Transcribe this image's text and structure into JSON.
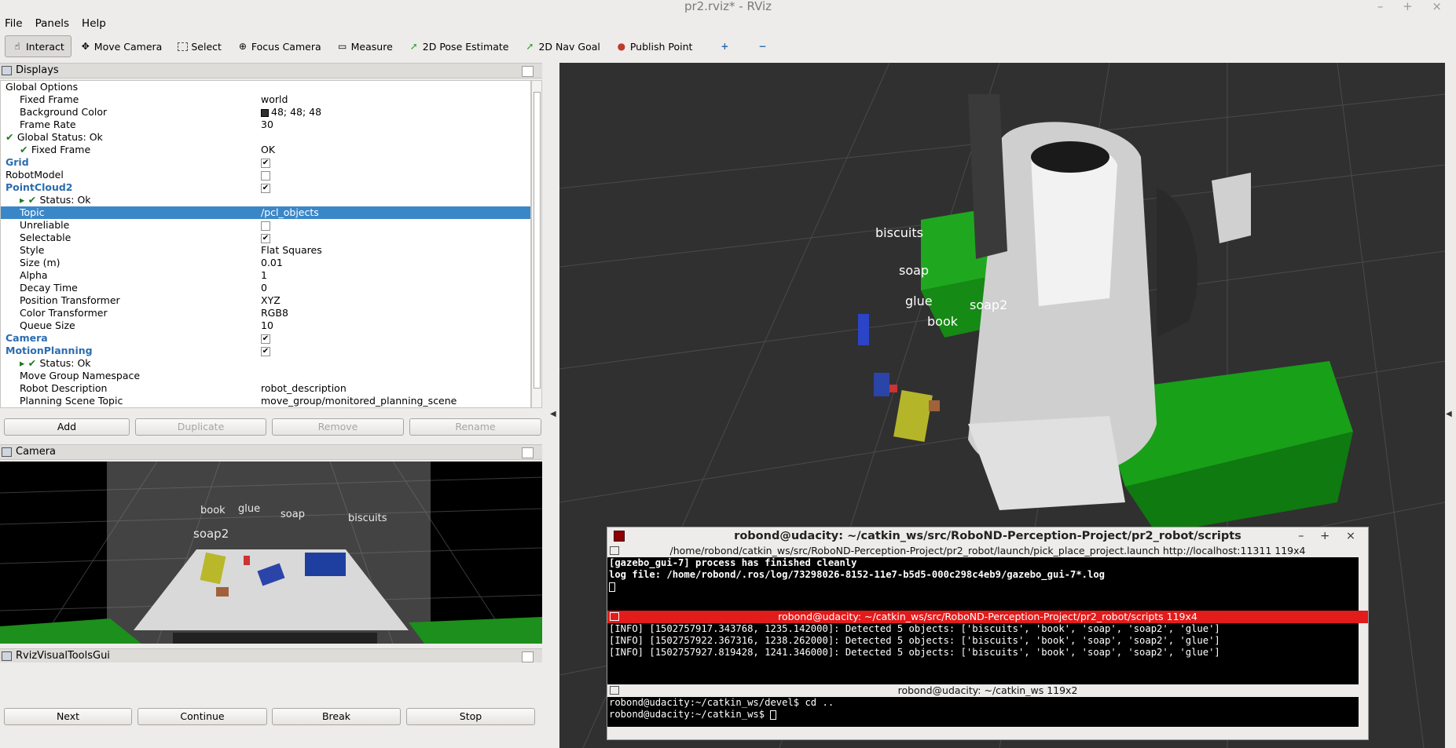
{
  "window": {
    "title": "pr2.rviz* - RViz",
    "controls": "– + ×"
  },
  "menu": [
    "File",
    "Panels",
    "Help"
  ],
  "toolbar": [
    {
      "label": "Interact",
      "icon": "hand-icon"
    },
    {
      "label": "Move Camera",
      "icon": "move-camera-icon"
    },
    {
      "label": "Select",
      "icon": "select-icon"
    },
    {
      "label": "Focus Camera",
      "icon": "focus-camera-icon"
    },
    {
      "label": "Measure",
      "icon": "measure-icon"
    },
    {
      "label": "2D Pose Estimate",
      "icon": "pose-estimate-icon"
    },
    {
      "label": "2D Nav Goal",
      "icon": "nav-goal-icon"
    },
    {
      "label": "Publish Point",
      "icon": "publish-point-icon"
    }
  ],
  "displays": {
    "title": "Displays",
    "rows": [
      {
        "k": "Global Options",
        "v": "",
        "indent": 1
      },
      {
        "k": "Fixed Frame",
        "v": "world",
        "indent": 2
      },
      {
        "k": "Background Color",
        "v": "48; 48; 48",
        "indent": 2,
        "swatch": "#303030"
      },
      {
        "k": "Frame Rate",
        "v": "30",
        "indent": 2
      },
      {
        "k": "Global Status: Ok",
        "v": "",
        "indent": 1,
        "tick": true
      },
      {
        "k": "Fixed Frame",
        "v": "OK",
        "indent": 2,
        "tick": true
      },
      {
        "k": "Grid",
        "v": "",
        "indent": 1,
        "bold": true,
        "check": true
      },
      {
        "k": "RobotModel",
        "v": "",
        "indent": 1,
        "check": false
      },
      {
        "k": "PointCloud2",
        "v": "",
        "indent": 1,
        "bold": true,
        "check": true
      },
      {
        "k": "Status: Ok",
        "v": "",
        "indent": 2,
        "tick": true,
        "arrow": true
      },
      {
        "k": "Topic",
        "v": "/pcl_objects",
        "indent": 2,
        "sel": true
      },
      {
        "k": "Unreliable",
        "v": "",
        "indent": 2,
        "check": false
      },
      {
        "k": "Selectable",
        "v": "",
        "indent": 2,
        "check": true
      },
      {
        "k": "Style",
        "v": "Flat Squares",
        "indent": 2
      },
      {
        "k": "Size (m)",
        "v": "0.01",
        "indent": 2
      },
      {
        "k": "Alpha",
        "v": "1",
        "indent": 2
      },
      {
        "k": "Decay Time",
        "v": "0",
        "indent": 2
      },
      {
        "k": "Position Transformer",
        "v": "XYZ",
        "indent": 2
      },
      {
        "k": "Color Transformer",
        "v": "RGB8",
        "indent": 2
      },
      {
        "k": "Queue Size",
        "v": "10",
        "indent": 2
      },
      {
        "k": "Camera",
        "v": "",
        "indent": 1,
        "bold": true,
        "check": true
      },
      {
        "k": "MotionPlanning",
        "v": "",
        "indent": 1,
        "bold": true,
        "check": true
      },
      {
        "k": "Status: Ok",
        "v": "",
        "indent": 2,
        "tick": true,
        "arrow": true
      },
      {
        "k": "Move Group Namespace",
        "v": "",
        "indent": 2
      },
      {
        "k": "Robot Description",
        "v": "robot_description",
        "indent": 2
      },
      {
        "k": "Planning Scene Topic",
        "v": "move_group/monitored_planning_scene",
        "indent": 2
      }
    ],
    "buttons": {
      "add": "Add",
      "duplicate": "Duplicate",
      "remove": "Remove",
      "rename": "Rename"
    }
  },
  "camera_panel": {
    "title": "Camera",
    "labels": [
      "book",
      "glue",
      "soap",
      "biscuits",
      "soap2"
    ]
  },
  "rviz_visual_tools": {
    "title": "RvizVisualToolsGui",
    "buttons": [
      "Next",
      "Continue",
      "Break",
      "Stop"
    ]
  },
  "scene_labels": [
    "biscuits",
    "soap",
    "glue",
    "soap2",
    "book"
  ],
  "terminal": {
    "title": "robond@udacity: ~/catkin_ws/src/RoboND-Perception-Project/pr2_robot/scripts",
    "tab1": "/home/robond/catkin_ws/src/RoboND-Perception-Project/pr2_robot/launch/pick_place_project.launch http://localhost:11311 119x4",
    "tab1_lines": [
      "[gazebo_gui-7] process has finished cleanly",
      "log file: /home/robond/.ros/log/73298026-8152-11e7-b5d5-000c298c4eb9/gazebo_gui-7*.log"
    ],
    "tab2": "robond@udacity: ~/catkin_ws/src/RoboND-Perception-Project/pr2_robot/scripts 119x4",
    "tab2_lines": [
      "[INFO] [1502757917.343768, 1235.142000]: Detected 5 objects: ['biscuits', 'book', 'soap', 'soap2', 'glue']",
      "[INFO] [1502757922.367316, 1238.262000]: Detected 5 objects: ['biscuits', 'book', 'soap', 'soap2', 'glue']",
      "[INFO] [1502757927.819428, 1241.346000]: Detected 5 objects: ['biscuits', 'book', 'soap', 'soap2', 'glue']"
    ],
    "tab3": "robond@udacity: ~/catkin_ws 119x2",
    "tab3_lines": [
      "robond@udacity:~/catkin_ws/devel$ cd ..",
      "robond@udacity:~/catkin_ws$ "
    ]
  }
}
